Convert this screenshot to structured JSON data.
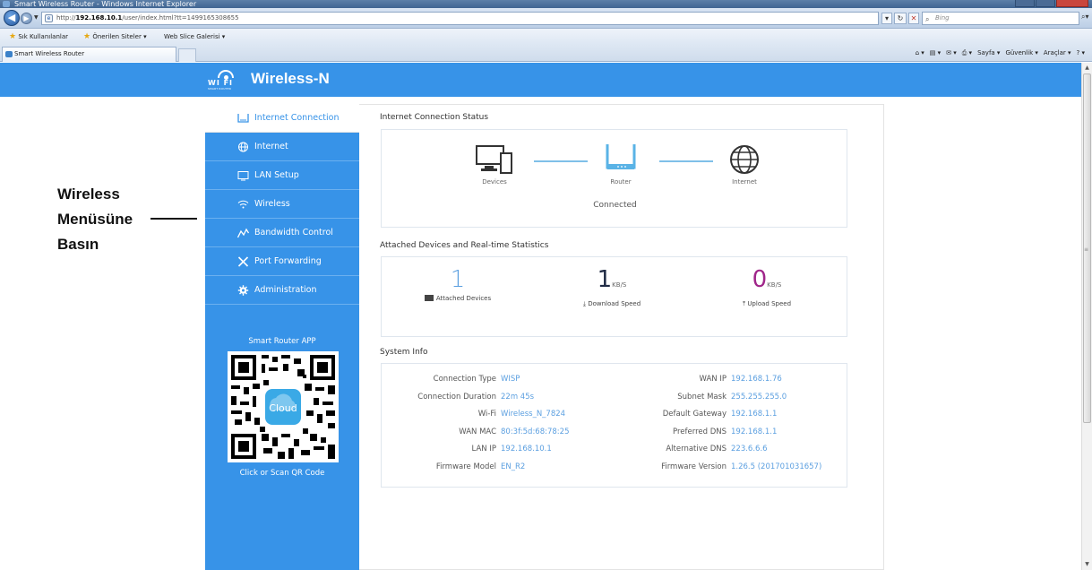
{
  "window": {
    "title": "Smart Wireless Router - Windows Internet Explorer"
  },
  "address_bar": {
    "url_prefix": "http://",
    "url_host": "192.168.10.1",
    "url_path": "/user/index.html?tt=1499165308655",
    "search_placeholder": "Bing"
  },
  "favorites_bar": {
    "favorites": "Sık Kullanılanlar",
    "suggested": "Önerilen Siteler ▾",
    "web_slice": "Web Slice Galerisi ▾"
  },
  "tab": {
    "label": "Smart Wireless Router"
  },
  "command_bar": {
    "page": "Sayfa ▾",
    "safety": "Güvenlik ▾",
    "tools": "Araçlar ▾"
  },
  "header": {
    "logo_text": "WI FI",
    "logo_sub": "SMART ROUTER",
    "brand": "Wireless-N"
  },
  "sidebar": {
    "items": [
      {
        "label": "Internet Connection",
        "icon": "router-icon",
        "active": true
      },
      {
        "label": "Internet",
        "icon": "globe-icon"
      },
      {
        "label": "LAN Setup",
        "icon": "monitor-icon"
      },
      {
        "label": "Wireless",
        "icon": "wifi-icon"
      },
      {
        "label": "Bandwidth Control",
        "icon": "bandwidth-icon"
      },
      {
        "label": "Port Forwarding",
        "icon": "tools-icon"
      },
      {
        "label": "Administration",
        "icon": "gear-icon"
      }
    ],
    "app_title": "Smart Router APP",
    "qr_logo": "Cloud",
    "qr_caption": "Click or Scan QR Code"
  },
  "status": {
    "title": "Internet Connection Status",
    "devices": "Devices",
    "router": "Router",
    "internet": "Internet",
    "state": "Connected"
  },
  "stats": {
    "title": "Attached Devices and Real-time Statistics",
    "attached_value": "1",
    "attached_label": "Attached Devices",
    "download_value": "1",
    "download_unit": "KB/S",
    "download_label": "Download Speed",
    "upload_value": "0",
    "upload_unit": "KB/S",
    "upload_label": "Upload Speed",
    "colors": {
      "attached": "#5b9fe0",
      "download": "#1f2a44",
      "upload": "#a0268a"
    }
  },
  "system_info": {
    "title": "System Info",
    "left": [
      {
        "key": "Connection Type",
        "value": "WISP"
      },
      {
        "key": "Connection Duration",
        "value": "22m 45s"
      },
      {
        "key": "Wi-Fi",
        "value": "Wireless_N_7824"
      },
      {
        "key": "WAN MAC",
        "value": "80:3f:5d:68:78:25"
      },
      {
        "key": "LAN IP",
        "value": "192.168.10.1"
      },
      {
        "key": "Firmware Model",
        "value": "EN_R2"
      }
    ],
    "right": [
      {
        "key": "WAN IP",
        "value": "192.168.1.76"
      },
      {
        "key": "Subnet Mask",
        "value": "255.255.255.0"
      },
      {
        "key": "Default Gateway",
        "value": "192.168.1.1"
      },
      {
        "key": "Preferred DNS",
        "value": "192.168.1.1"
      },
      {
        "key": "Alternative DNS",
        "value": "223.6.6.6"
      },
      {
        "key": "Firmware Version",
        "value": "1.26.5 (201701031657)"
      }
    ]
  },
  "annotation": {
    "line1": "Wireless",
    "line2": "Menüsüne",
    "line3": "Basın"
  },
  "theme": {
    "accent": "#3793e8",
    "value_color": "#5b9fe0"
  }
}
